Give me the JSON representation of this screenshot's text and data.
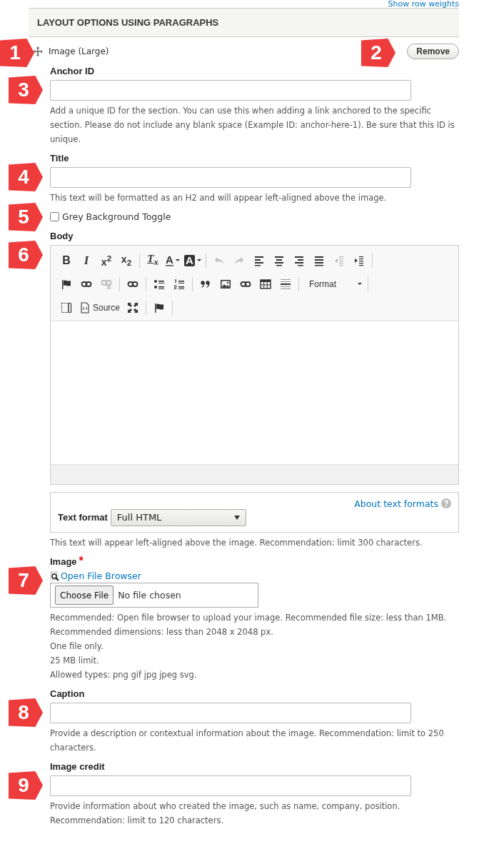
{
  "top_link": "Show row weights",
  "section": {
    "title": "LAYOUT OPTIONS USING PARAGRAPHS"
  },
  "paragraph": {
    "title": "Image (Large)",
    "remove_button": "Remove",
    "marker": "1",
    "remove_marker": "2"
  },
  "fields": [
    {
      "kind": "text",
      "marker": "3",
      "label": "Anchor ID",
      "description": [
        "Add a unique ID for the section. You can use this when adding a link anchored to the specific section. Please do not include any blank space (Example ID: anchor-here-1). Be sure that this ID is unique."
      ]
    },
    {
      "kind": "text",
      "marker": "4",
      "label": "Title",
      "description": [
        "This text will be formatted as an H2 and will appear left-aligned above the image."
      ]
    },
    {
      "kind": "checkbox",
      "marker": "5",
      "label": "Grey Background Toggle",
      "checked": false
    },
    {
      "kind": "editor",
      "marker": "6",
      "label": "Body",
      "toolbar": [
        [
          [
            {
              "kind": "bold",
              "glyph": "B",
              "disabled": false
            },
            {
              "kind": "italic",
              "glyph": "I",
              "disabled": false
            },
            {
              "kind": "superscript",
              "glyph": "x$^{2}$",
              "disabled": false
            },
            {
              "kind": "subscript",
              "glyph": "x$_{2}$",
              "disabled": false
            }
          ],
          [
            {
              "kind": "removeformat",
              "glyph": "T$_{x}$",
              "disabled": false
            },
            {
              "kind": "textcolor",
              "glyph": "A",
              "disabled": false
            },
            {
              "kind": "bgcolor",
              "glyph": "A",
              "disabled": false
            }
          ],
          [
            {
              "kind": "undo",
              "disabled": true
            },
            {
              "kind": "redo",
              "disabled": true
            },
            {
              "kind": "alignleft",
              "disabled": false
            },
            {
              "kind": "aligncenter",
              "disabled": false
            },
            {
              "kind": "alignright",
              "disabled": false
            },
            {
              "kind": "justify",
              "disabled": false
            },
            {
              "kind": "outdent",
              "disabled": true
            },
            {
              "kind": "indent",
              "disabled": false
            }
          ]
        ],
        [
          [
            {
              "kind": "flag",
              "disabled": false
            },
            {
              "kind": "link",
              "disabled": false
            },
            {
              "kind": "unlink",
              "disabled": true
            }
          ],
          [
            {
              "kind": "link",
              "disabled": false
            }
          ],
          [
            {
              "kind": "bulletlist",
              "disabled": false
            },
            {
              "kind": "numberlist",
              "disabled": false
            }
          ],
          [
            {
              "kind": "blockquote",
              "disabled": false
            },
            {
              "kind": "image",
              "disabled": false
            },
            {
              "kind": "link",
              "disabled": false
            },
            {
              "kind": "table",
              "disabled": false
            },
            {
              "kind": "hr",
              "disabled": false
            }
          ],
          [
            {
              "kind": "combo",
              "label": "Format",
              "disabled": false
            }
          ]
        ],
        [
          [
            {
              "kind": "templates",
              "disabled": false
            },
            {
              "kind": "source",
              "label": "Source",
              "disabled": false
            },
            {
              "kind": "maximize",
              "disabled": false
            }
          ],
          [
            {
              "kind": "flag",
              "disabled": false
            }
          ]
        ]
      ],
      "text_format": {
        "label": "Text format",
        "value": "Full HTML",
        "help_link": "About text formats"
      },
      "description": [
        "This text will appear left-aligned above the image. Recommendation: limit 300 characters."
      ]
    },
    {
      "kind": "file",
      "marker": "7",
      "label": "Image",
      "required_mark": "*",
      "browse_link": "Open File Browser",
      "choose_button": "Choose File",
      "file_status": "No file chosen",
      "description": [
        "Recommended: Open file browser to upload your image. Recommended file size: less than 1MB. Recommended dimensions: less than 2048 x 2048 px.",
        "One file only.",
        "25 MB limit.",
        "Allowed types: png gif jpg jpeg svg."
      ]
    },
    {
      "kind": "text",
      "marker": "8",
      "label": "Caption",
      "description": [
        "Provide a description or contextual information about the image. Recommendation: limit to 250 characters."
      ]
    },
    {
      "kind": "text",
      "marker": "9",
      "label": "Image credit",
      "description": [
        "Provide information about who created the image, such as name, company, position. Recommendation: limit to 120 characters."
      ]
    }
  ]
}
